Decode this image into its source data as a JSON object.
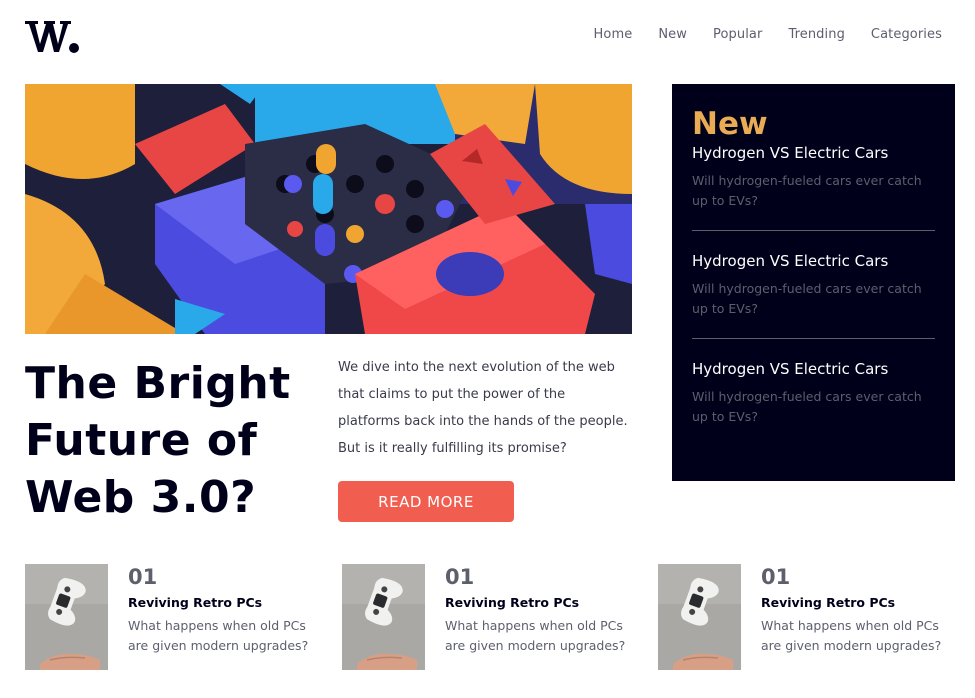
{
  "header": {
    "logo_text": "W.",
    "nav": [
      {
        "label": "Home"
      },
      {
        "label": "New"
      },
      {
        "label": "Popular"
      },
      {
        "label": "Trending"
      },
      {
        "label": "Categories"
      }
    ]
  },
  "hero": {
    "title": "The Bright Future of Web 3.0?",
    "description": "We dive into the next evolution of the web that claims to put the power of the platforms back into the hands of the people. But is it really fulfilling its promise?",
    "button_label": "READ MORE"
  },
  "new_panel": {
    "heading": "New",
    "items": [
      {
        "title": "Hydrogen VS Electric Cars",
        "desc": "Will hydrogen-fueled cars ever catch up to EVs?"
      },
      {
        "title": "Hydrogen VS Electric Cars",
        "desc": "Will hydrogen-fueled cars ever catch up to EVs?"
      },
      {
        "title": "Hydrogen VS Electric Cars",
        "desc": "Will hydrogen-fueled cars ever catch up to EVs?"
      }
    ]
  },
  "cards": [
    {
      "number": "01",
      "title": "Reviving Retro PCs",
      "desc": "What happens when old PCs are given modern upgrades?"
    },
    {
      "number": "01",
      "title": "Reviving Retro PCs",
      "desc": "What happens when old PCs are given modern upgrades?"
    },
    {
      "number": "01",
      "title": "Reviving Retro PCs",
      "desc": "What happens when old PCs are given modern upgrades?"
    }
  ],
  "colors": {
    "dark": "#00001a",
    "accent_red": "#f15e50",
    "accent_orange": "#e9ab53",
    "muted": "#5d5f6d"
  }
}
